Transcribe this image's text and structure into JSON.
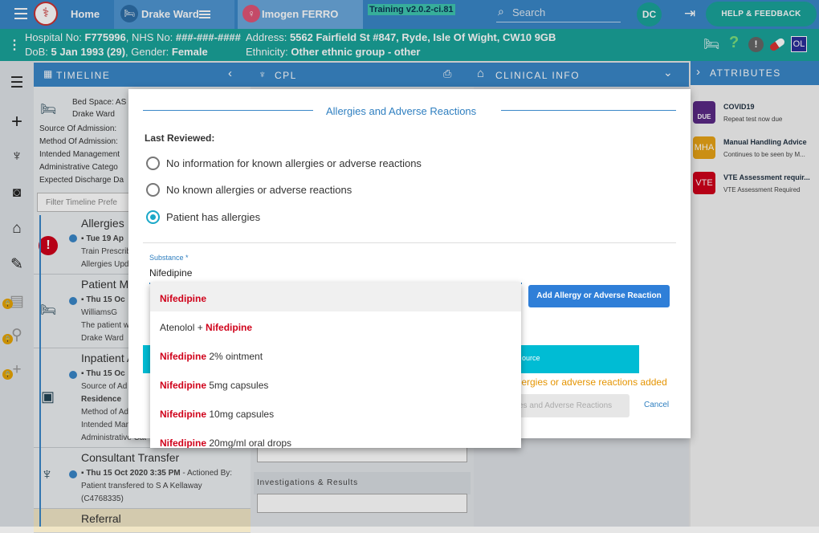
{
  "topbar": {
    "home_label": "Home",
    "ward_label": "Drake Ward",
    "patient_name": "Imogen FERRO",
    "version": "Training v2.0.2-ci.81",
    "search_placeholder": "Search",
    "user_initials": "DC",
    "help_label": "HELP & FEEDBACK"
  },
  "patient": {
    "hospital_no_label": "Hospital No:",
    "hospital_no": "F775996",
    "nhs_no_label": "NHS No:",
    "nhs_no": "###-###-####",
    "address_label": "Address:",
    "address": "5562 Fairfield St #847, Ryde, Isle Of Wight, CW10 9GB",
    "dob_label": "DoB:",
    "dob": "5 Jan 1993 (29)",
    "gender_label": "Gender:",
    "gender": "Female",
    "ethnicity_label": "Ethnicity:",
    "ethnicity": "Other ethnic group - other",
    "badge_initials": "OL"
  },
  "panels": {
    "timeline": "TIMELINE",
    "cpl": "CPL",
    "clinical_info": "CLINICAL INFO",
    "attributes": "ATTRIBUTES"
  },
  "timeline": {
    "bed_space": "Bed Space: AS",
    "ward": "Drake Ward",
    "fields": [
      "Source Of Admission:",
      "Method Of Admission:",
      "Intended Management",
      "Administrative Catego",
      "Expected Discharge Da"
    ],
    "filter_placeholder": "Filter Timeline Prefe",
    "entries": [
      {
        "title": "Allergies",
        "date": "Tue 19 Ap",
        "lines": [
          "Train Prescrib",
          "Allergies Upd"
        ]
      },
      {
        "title": "Patient Mo",
        "date": "Thu 15 Oc",
        "lines": [
          "WilliamsG",
          "The patient w",
          "Drake Ward"
        ]
      },
      {
        "title": "Inpatient A",
        "date": "Thu 15 Oc",
        "lines": [
          "Source of Ad",
          "Residence",
          "Method of Ad",
          "Intended Man",
          "Administrative Cat"
        ]
      },
      {
        "title": "Consultant Transfer",
        "date": "Thu 15 Oct 2020 3:35 PM",
        "actioned": " - Actioned By:",
        "lines": [
          "Patient transfered to S A Kellaway",
          "(C4768335)"
        ]
      },
      {
        "title": "Referral",
        "date": "",
        "lines": []
      }
    ]
  },
  "middle": {
    "investigations_label": "Investigations & Results"
  },
  "modal": {
    "title": "Allergies and Adverse Reactions",
    "last_reviewed_label": "Last Reviewed:",
    "options": [
      "No information for known allergies or adverse reactions",
      "No known allergies or adverse reactions",
      "Patient has allergies"
    ],
    "selected_option": 2,
    "substance_label": "Substance *",
    "substance_value": "Nifedipine",
    "add_button": "Add Allergy or Adverse Reaction",
    "source_text": "ource",
    "warning_text": "llergies or adverse reactions added",
    "save_button": "es and Adverse Reactions",
    "cancel_button": "Cancel"
  },
  "dropdown": {
    "items": [
      {
        "pre": "",
        "match": "Nifedipine",
        "post": ""
      },
      {
        "pre": "Atenolol + ",
        "match": "Nifedipine",
        "post": ""
      },
      {
        "pre": "",
        "match": "Nifedipine",
        "post": " 2% ointment"
      },
      {
        "pre": "",
        "match": "Nifedipine",
        "post": " 5mg capsules"
      },
      {
        "pre": "",
        "match": "Nifedipine",
        "post": " 10mg capsules"
      },
      {
        "pre": "",
        "match": "Nifedipine",
        "post": " 20mg/ml oral drops"
      }
    ]
  },
  "attributes": [
    {
      "badge": "DUE",
      "title": "COVID19",
      "desc": "Repeat test now due",
      "color": "#5b2a86"
    },
    {
      "badge": "MHA",
      "title": "Manual Handling Advice",
      "desc": "Continues to be seen by M...",
      "color": "#e8a317"
    },
    {
      "badge": "VTE",
      "title": "VTE Assessment requir...",
      "desc": "VTE Assessment Required",
      "color": "#d0021b"
    }
  ],
  "colors": {
    "primary": "#3a87c8",
    "teal": "#1aa39a",
    "match_red": "#d0021b",
    "warning_orange": "#e59400",
    "cyan_bar": "#00bcd4"
  }
}
